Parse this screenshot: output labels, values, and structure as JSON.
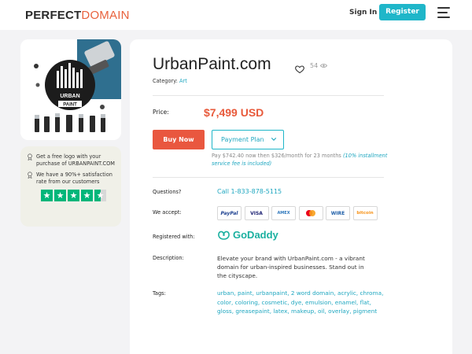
{
  "brand": {
    "logo_part1": "PERFECT",
    "logo_part2": "DOMAIN"
  },
  "header": {
    "signin_label": "Sign In",
    "register_label": "Register"
  },
  "domain": {
    "name": "UrbanPaint.com",
    "views": "54",
    "category_label": "Category:",
    "category": "Art",
    "image_text": "URBAN PAINT"
  },
  "pricing": {
    "price_label": "Price:",
    "price": "$7,499 USD",
    "buy_now_label": "Buy Now",
    "payment_plan_label": "Payment Plan",
    "plan_note": "Pay $742.40 now then $326/month for 23 months",
    "plan_fee_note": "(10% installment service fee is included)"
  },
  "details": {
    "questions_label": "Questions?",
    "phone": "Call 1-833-878-5115",
    "accept_label": "We accept:",
    "payment_methods": [
      "PayPal",
      "VISA",
      "AMEX",
      "MC",
      "WIRE",
      "bitcoin"
    ],
    "registered_label": "Registered with:",
    "registrar": "GoDaddy",
    "description_label": "Description:",
    "description": "Elevate your brand with UrbanPaint.com - a vibrant domain for urban-inspired businesses. Stand out in the cityscape.",
    "tags_label": "Tags:",
    "tags": "urban, paint, urbanpaint, 2 word domain, acrylic, chroma, color, coloring, cosmetic, dye, emulsion, enamel, flat, gloss, greasepaint, latex, makeup, oil, overlay, pigment"
  },
  "perks": {
    "item1": "Get a free logo with your purchase of URBANPAINT.COM",
    "item2": "We have a 90%+ satisfaction rate from our customers"
  },
  "colors": {
    "accent": "#1fb6c9",
    "buy": "#e9573f",
    "price": "#e85a3b",
    "trustpilot": "#00b67a",
    "logo_orange": "#e8623d"
  }
}
